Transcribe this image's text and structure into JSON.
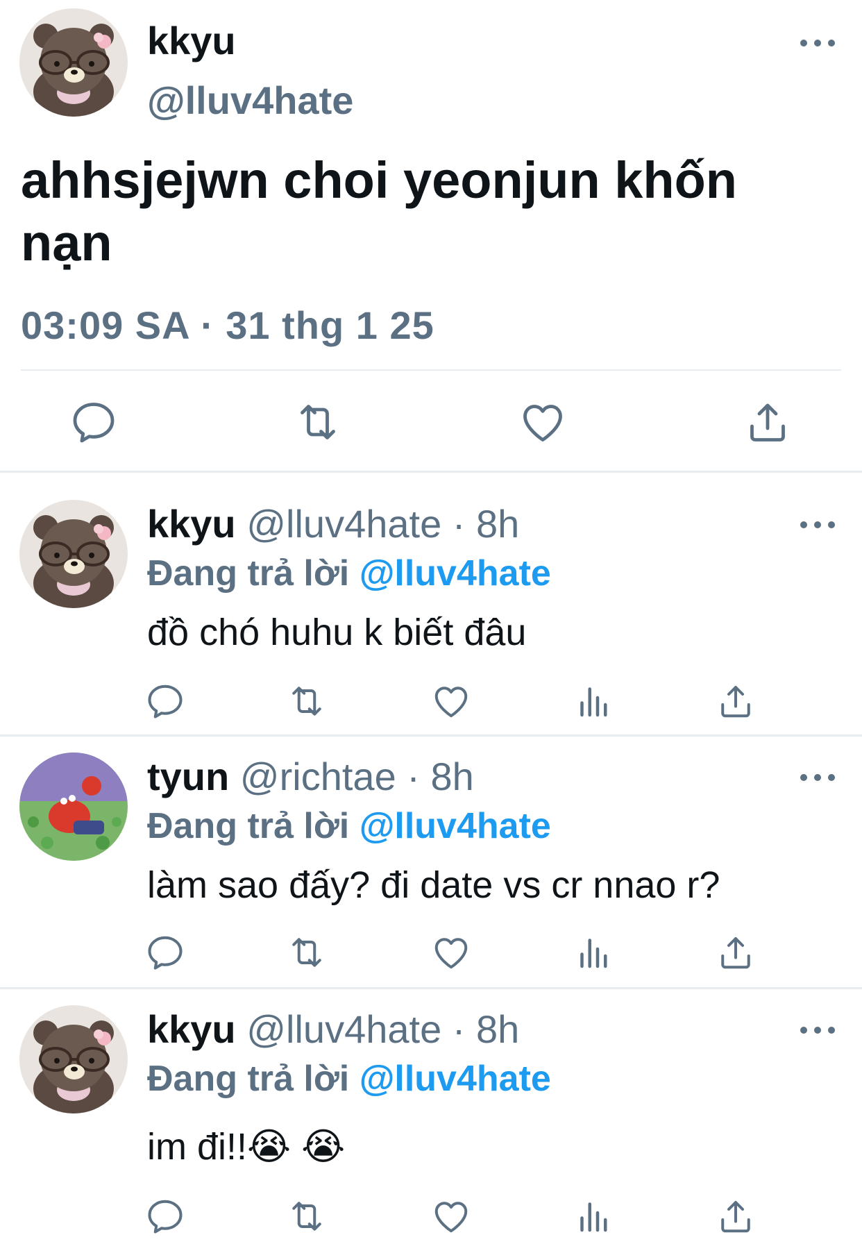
{
  "main_tweet": {
    "name": "kkyu",
    "handle": "@lluv4hate",
    "text_line1": "ahhsjejwn choi yeonjun khốn",
    "text_line2": "nạn",
    "time": "03:09 SA",
    "separator": "·",
    "date": "31 thg 1 25",
    "avatar_icon": "bear-avatar",
    "actions": [
      "reply-icon",
      "retweet-icon",
      "like-icon",
      "share-icon"
    ]
  },
  "replies": [
    {
      "name": "kkyu",
      "handle": "@lluv4hate",
      "dot": "·",
      "time": "8h",
      "replying_prefix": "Đang trả lời",
      "replying_to": "@lluv4hate",
      "text": "đồ chó huhu k biết đâu",
      "avatar_icon": "bear-avatar"
    },
    {
      "name": "tyun",
      "handle": "@richtae",
      "dot": "·",
      "time": "8h",
      "replying_prefix": "Đang trả lời",
      "replying_to": "@lluv4hate",
      "text": "làm sao đấy? đi date vs cr nnao r?",
      "avatar_icon": "crab-money-avatar"
    },
    {
      "name": "kkyu",
      "handle": "@lluv4hate",
      "dot": "·",
      "time": "8h",
      "replying_prefix": "Đang trả lời",
      "replying_to": "@lluv4hate",
      "text": "im đi!!😭 😭",
      "avatar_icon": "bear-avatar"
    }
  ],
  "colors": {
    "text": "#0f1419",
    "secondary": "#5b7083",
    "link": "#1d9bf0",
    "divider": "#e6ecf0"
  }
}
